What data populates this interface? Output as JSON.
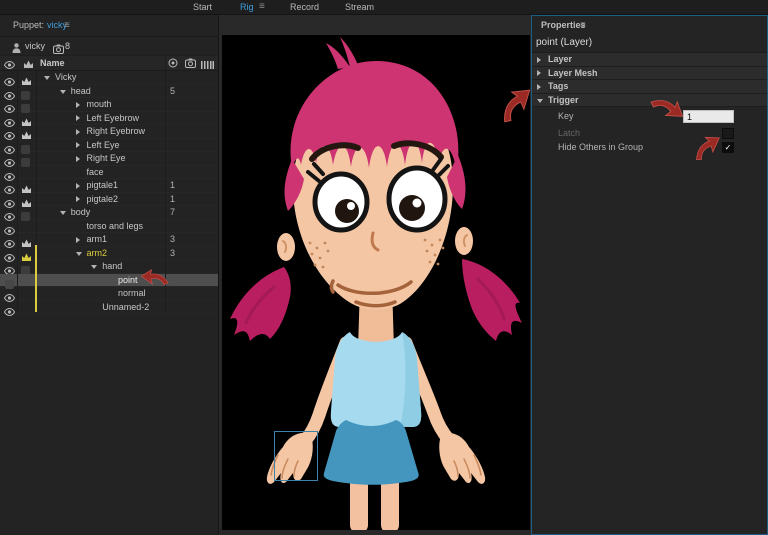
{
  "topbar": {
    "tabs": [
      {
        "label": "Start",
        "active": false
      },
      {
        "label": "Rig",
        "active": true
      },
      {
        "label": "Record",
        "active": false
      },
      {
        "label": "Stream",
        "active": false
      }
    ],
    "workspace_menu_icon": "≡"
  },
  "puppet_panel": {
    "header": {
      "prefix": "Puppet:",
      "puppet_name": "vicky",
      "menu_icon": "≡"
    },
    "puppet_row": {
      "name": "vicky",
      "badge_icon": "camera-icon",
      "badge_count": "8"
    },
    "columns": {
      "name_header": "Name",
      "right_icons": [
        "record-dot-icon",
        "camera-icon",
        "timeline-icon"
      ]
    },
    "rows": [
      {
        "label": "Vicky",
        "indent": 0,
        "twirl": "open",
        "eye": "on",
        "crown": "white",
        "value": ""
      },
      {
        "label": "head",
        "indent": 1,
        "twirl": "open",
        "eye": "on",
        "crown": "square",
        "value": "5"
      },
      {
        "label": "mouth",
        "indent": 2,
        "twirl": "closed",
        "eye": "on",
        "crown": "square",
        "value": ""
      },
      {
        "label": "Left Eyebrow",
        "indent": 2,
        "twirl": "closed",
        "eye": "on",
        "crown": "white",
        "value": ""
      },
      {
        "label": "Right Eyebrow",
        "indent": 2,
        "twirl": "closed",
        "eye": "on",
        "crown": "white",
        "value": ""
      },
      {
        "label": "Left Eye",
        "indent": 2,
        "twirl": "closed",
        "eye": "on",
        "crown": "square",
        "value": ""
      },
      {
        "label": "Right Eye",
        "indent": 2,
        "twirl": "closed",
        "eye": "on",
        "crown": "square",
        "value": ""
      },
      {
        "label": "face",
        "indent": 2,
        "twirl": "none",
        "eye": "on",
        "crown": "none",
        "value": ""
      },
      {
        "label": "pigtale1",
        "indent": 2,
        "twirl": "closed",
        "eye": "on",
        "crown": "white",
        "value": "1"
      },
      {
        "label": "pigtale2",
        "indent": 2,
        "twirl": "closed",
        "eye": "on",
        "crown": "white",
        "value": "1"
      },
      {
        "label": "body",
        "indent": 1,
        "twirl": "open",
        "eye": "on",
        "crown": "square",
        "value": "7"
      },
      {
        "label": "torso and legs",
        "indent": 2,
        "twirl": "none",
        "eye": "on",
        "crown": "none",
        "value": ""
      },
      {
        "label": "arm1",
        "indent": 2,
        "twirl": "closed",
        "eye": "on",
        "crown": "white",
        "value": "3"
      },
      {
        "label": "arm2",
        "indent": 2,
        "twirl": "open",
        "eye": "on",
        "crown": "yellow",
        "value": "3",
        "armed": true
      },
      {
        "label": "hand",
        "indent": 3,
        "twirl": "open",
        "eye": "on",
        "crown": "square",
        "value": ""
      },
      {
        "label": "point",
        "indent": 4,
        "twirl": "none",
        "eye": "hidden",
        "crown": "none",
        "value": "",
        "selected": true
      },
      {
        "label": "normal",
        "indent": 4,
        "twirl": "none",
        "eye": "on",
        "crown": "none",
        "value": ""
      },
      {
        "label": "Unnamed-2",
        "indent": 3,
        "twirl": "none",
        "eye": "on",
        "crown": "none",
        "value": ""
      }
    ]
  },
  "properties_panel": {
    "title": "Properties",
    "menu_icon": "≡",
    "subtitle": "point (Layer)",
    "sections": [
      {
        "label": "Layer",
        "expanded": false
      },
      {
        "label": "Layer Mesh",
        "expanded": false
      },
      {
        "label": "Tags",
        "expanded": false
      },
      {
        "label": "Trigger",
        "expanded": true
      }
    ],
    "trigger_fields": {
      "key_label": "Key",
      "key_value": "1",
      "latch_label": "Latch",
      "latch_checked": false,
      "hide_label": "Hide Others in Group",
      "hide_checked": true,
      "check_glyph": "✓"
    }
  },
  "stage": {
    "background": "#000000",
    "character": "vicky cartoon girl with pink pigtails, blue tank top and skirt",
    "selection_target": "hand point handle"
  },
  "annotations": {
    "arrows": [
      {
        "points_to": "point-layer-row",
        "direction": "left"
      },
      {
        "points_to": "trigger-section",
        "direction": "up-right"
      },
      {
        "points_to": "key-input",
        "direction": "down-right"
      },
      {
        "points_to": "hide-others-checkbox",
        "direction": "up-right"
      }
    ]
  },
  "colors": {
    "accent_blue": "#3f9fdc",
    "panel_focus_border": "#1d5f82",
    "armed_yellow": "#d9cd3f",
    "annotation_red": "#9b2a24",
    "selection_box_blue": "#3c82aa",
    "hair_pink": "#ce3372",
    "pigtail_pink": "#b91e60",
    "skin": "#f5c6a3",
    "top_blue": "#a6daee",
    "skirt_blue": "#4496be"
  }
}
